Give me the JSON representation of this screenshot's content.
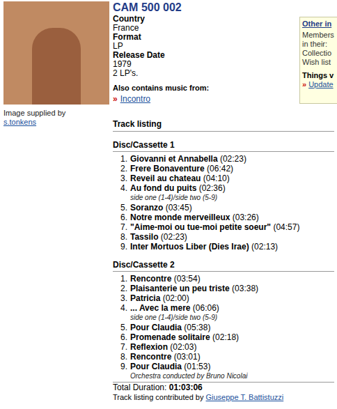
{
  "image": {
    "caption": "Image supplied by",
    "supplier": "s.tonkens"
  },
  "release": {
    "catalog": "CAM 500 002",
    "fields": [
      {
        "label": "Country",
        "value": "France"
      },
      {
        "label": "Format",
        "value": "LP"
      },
      {
        "label": "Release Date",
        "value": "1979"
      }
    ],
    "note": "2 LP's.",
    "also_contains_label": "Also contains music from:",
    "also_contains": [
      {
        "bullet": "»",
        "title": "Incontro"
      }
    ]
  },
  "side_box": {
    "title": "Other in",
    "lines": [
      "Members",
      "in their:",
      "Collectio",
      "Wish list"
    ],
    "section": "Things v",
    "links": [
      {
        "bullet": "»",
        "title": "Update"
      }
    ]
  },
  "track_listing": {
    "title": "Track listing",
    "discs": [
      {
        "title": "Disc/Cassette 1",
        "items": [
          {
            "kind": "track",
            "number": "1.",
            "title": "Giovanni et Annabella",
            "duration": "(02:23)"
          },
          {
            "kind": "track",
            "number": "2.",
            "title": "Frere Bonaventure",
            "duration": "(06:42)"
          },
          {
            "kind": "track",
            "number": "3.",
            "title": "Reveil au chateau",
            "duration": "(04:10)"
          },
          {
            "kind": "track",
            "number": "4.",
            "title": "Au fond du puits",
            "duration": "(02:36)"
          },
          {
            "kind": "note",
            "text": "side one (1-4)/side two (5-9)"
          },
          {
            "kind": "track",
            "number": "5.",
            "title": "Soranzo",
            "duration": "(03:45)"
          },
          {
            "kind": "track",
            "number": "6.",
            "title": "Notre monde merveilleux",
            "duration": "(03:26)"
          },
          {
            "kind": "track",
            "number": "7.",
            "title": "\"Aime-moi ou tue-moi petite soeur\"",
            "duration": "(04:57)"
          },
          {
            "kind": "track",
            "number": "8.",
            "title": "Tassilo",
            "duration": "(02:23)"
          },
          {
            "kind": "track",
            "number": "9.",
            "title": "Inter Mortuos Liber (Dies Irae)",
            "duration": "(02:13)"
          }
        ]
      },
      {
        "title": "Disc/Cassette 2",
        "items": [
          {
            "kind": "track",
            "number": "1.",
            "title": "Rencontre",
            "duration": "(03:54)"
          },
          {
            "kind": "track",
            "number": "2.",
            "title": "Plaisanterie un peu triste",
            "duration": "(03:38)"
          },
          {
            "kind": "track",
            "number": "3.",
            "title": "Patricia",
            "duration": "(02:00)"
          },
          {
            "kind": "track",
            "number": "4.",
            "title": "... Avec la mere",
            "duration": "(06:06)"
          },
          {
            "kind": "note",
            "text": "side one (1-4)/side two (5-9)"
          },
          {
            "kind": "track",
            "number": "5.",
            "title": "Pour Claudia",
            "duration": "(05:38)"
          },
          {
            "kind": "track",
            "number": "6.",
            "title": "Promenade solitaire",
            "duration": "(02:18)"
          },
          {
            "kind": "track",
            "number": "7.",
            "title": "Reflexion",
            "duration": "(02:03)"
          },
          {
            "kind": "track",
            "number": "8.",
            "title": "Rencontre",
            "duration": "(03:01)"
          },
          {
            "kind": "track",
            "number": "9.",
            "title": "Pour Claudia",
            "duration": "(01:53)"
          },
          {
            "kind": "note",
            "text": "Orchestra conducted by Bruno Nicolai"
          }
        ]
      }
    ],
    "total": {
      "label": "Total Duration:",
      "value": "01:03:06"
    },
    "contributed": {
      "label": "Track listing contributed by",
      "name": "Giuseppe T. Battistuzzi"
    }
  }
}
